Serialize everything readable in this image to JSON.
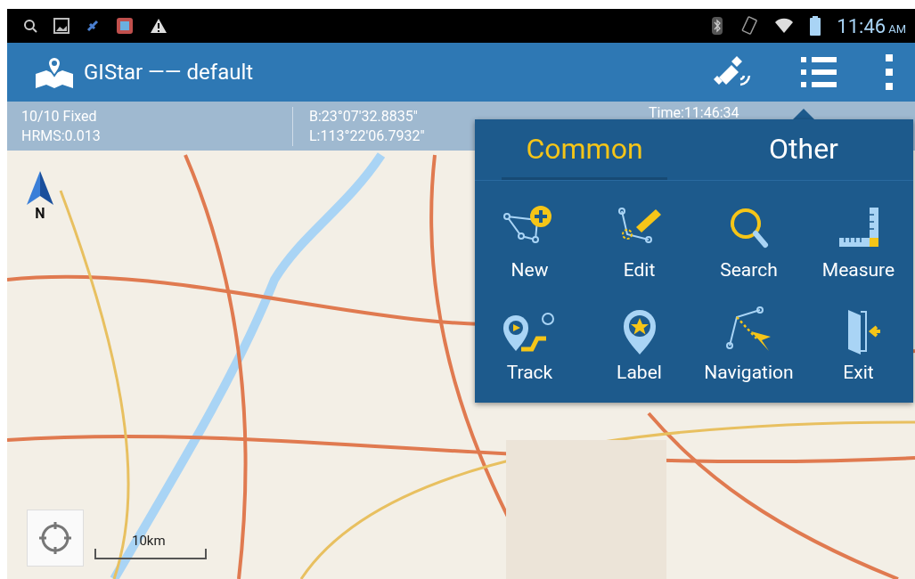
{
  "status_bar": {
    "time": "11:46",
    "meridiem": "AM"
  },
  "app_bar": {
    "title": "GIStar —— default"
  },
  "info": {
    "solution": "10/10  Fixed",
    "hrms": "HRMS:0.013",
    "latitude": "B:23°07'32.8835\"",
    "longitude": "L:113°22'06.7932\"",
    "time": "Time:11:46:34"
  },
  "map": {
    "north": "N",
    "scale": "10km"
  },
  "menu": {
    "tabs": [
      {
        "label": "Common",
        "selected": true
      },
      {
        "label": "Other",
        "selected": false
      }
    ],
    "items": [
      {
        "kind": "new",
        "label": "New"
      },
      {
        "kind": "edit",
        "label": "Edit"
      },
      {
        "kind": "search",
        "label": "Search"
      },
      {
        "kind": "measure",
        "label": "Measure"
      },
      {
        "kind": "track",
        "label": "Track"
      },
      {
        "kind": "label",
        "label": "Label"
      },
      {
        "kind": "navigation",
        "label": "Navigation"
      },
      {
        "kind": "exit",
        "label": "Exit"
      }
    ]
  }
}
